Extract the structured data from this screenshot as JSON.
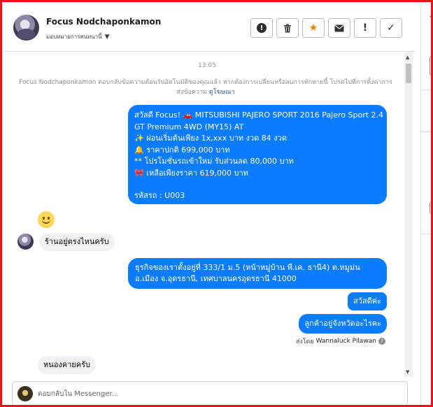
{
  "header": {
    "contact_name": "Focus Nodchaponkamon",
    "assign_label": "มอบหมายการสนทนานี้",
    "actions": [
      {
        "name": "spam-button",
        "glyph": "!"
      },
      {
        "name": "delete-button",
        "glyph": "🗑"
      },
      {
        "name": "star-button",
        "glyph": "★"
      },
      {
        "name": "mark-unread-button",
        "glyph": "✉"
      },
      {
        "name": "follow-up-button",
        "glyph": "!"
      },
      {
        "name": "mark-done-button",
        "glyph": "✓"
      }
    ]
  },
  "thread": {
    "timestamp": "13:05",
    "notice": "Focus Nodchaponkamon ตอบกลับข้อความต้อนรับอัตโนมัติของคุณแล้ว หากต้องการเปลี่ยนหรือลบการทักทายนี้ โปรดไปที่การตั้งค่าการส่งข้อความ",
    "notice_link": "ดูโฆษณา",
    "messages": {
      "offer": {
        "line1": "สวัสดี Focus! 🚗 MITSUBISHI PAJERO SPORT 2016 Pajero Sport 2.4",
        "line2": "GT Premium 4WD (MY15) AT",
        "line3": "✨ ผ่อนเริ่มต้นเพียง 1x,xxx บาท งวด 84 งวด",
        "line4": "🔔 ราคาปกติ 699,000 บาท",
        "line5": "** โปรโมชั่นรถเข้าใหม่ รับส่วนลด 80,000 บาท",
        "line6": "🎀 เหลือเพียงราคา 619,000 บาท",
        "line7": "รหัสรถ : U003"
      },
      "incoming_1": "ร้านอยู่ตรงไหนครับ",
      "address_line1": "ธุรกิจของเราตั้งอยู่ที่ 333/1 ม.5 (หน้าหมู่บ้าน พี.เค. ธานี4) ต.หมูม่น",
      "address_line2": "อ.เมือง จ.อุดรธานี, เทศบาลนครอุดรธานี 41000",
      "greeting": "สวัสดีค่ะ",
      "province_question": "ลูกค้าอยู่จังหวัดอะไรคะ",
      "sent_by_label": "ส่งโดย",
      "sent_by_name": "Wannaluck Pilawan",
      "incoming_2": "หนองคายครับ"
    }
  },
  "composer": {
    "placeholder": "ตอบกลับใน Messenger..."
  },
  "colors": {
    "outgoing_bubble": "#0a7cff",
    "incoming_bubble": "#f0f2f5",
    "frame_border": "#e8141b",
    "star": "#f57c00"
  }
}
